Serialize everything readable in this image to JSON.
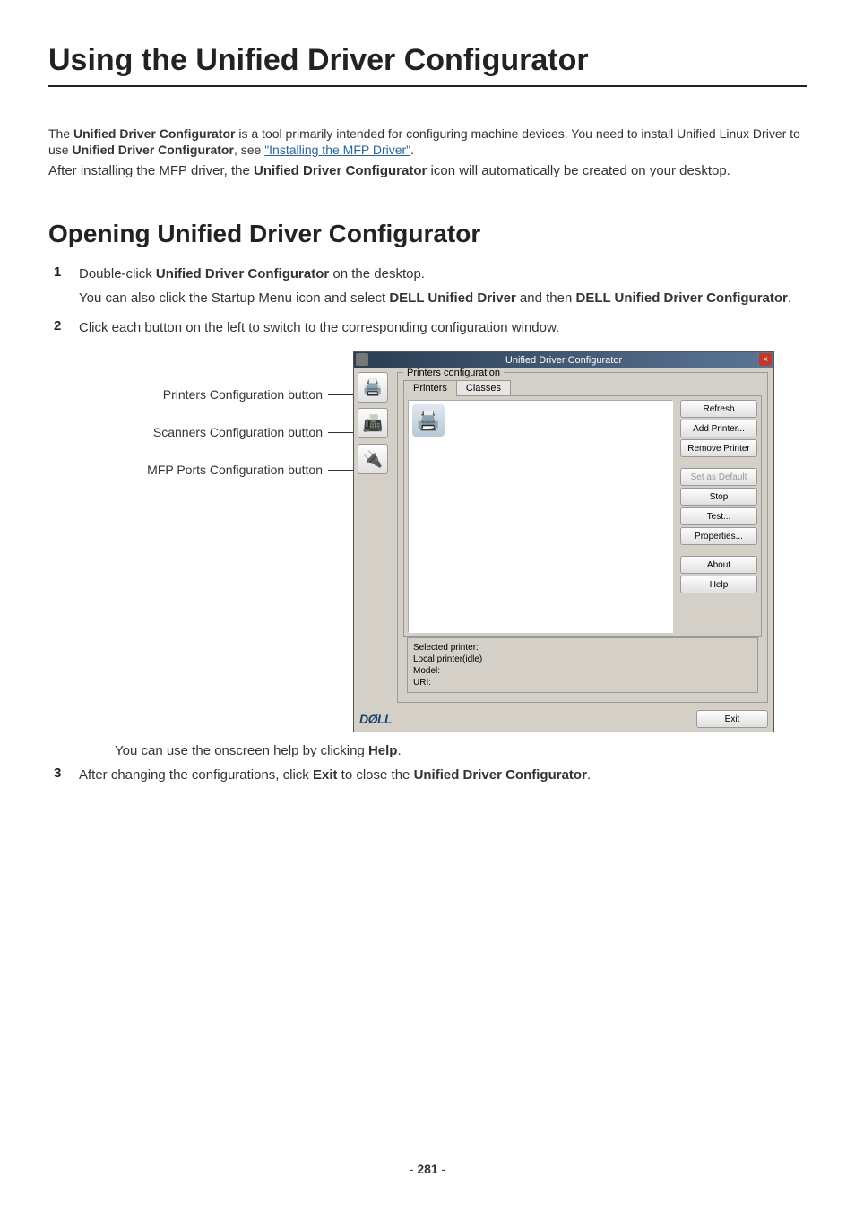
{
  "title": "Using the Unified Driver Configurator",
  "intro": {
    "line1_a": "The ",
    "line1_b": "Unified Driver Configurator",
    "line1_c": " is a tool primarily intended for configuring machine devices. You need to install Unified Linux Driver to use ",
    "line1_d": "Unified Driver Configurator",
    "line1_e": ", see ",
    "link": "\"Installing the MFP Driver\"",
    "line1_f": ".",
    "line2_a": "After installing the MFP driver, the ",
    "line2_b": "Unified Driver Configurator",
    "line2_c": " icon will automatically be created on your desktop."
  },
  "section_title": "Opening Unified Driver Configurator",
  "steps": {
    "s1": {
      "num": "1",
      "p1_a": "Double-click ",
      "p1_b": "Unified Driver Configurator",
      "p1_c": " on the desktop.",
      "p2_a": "You can also click the Startup Menu icon and select ",
      "p2_b": "DELL Unified Driver",
      "p2_c": " and then ",
      "p2_d": "DELL Unified Driver Configurator",
      "p2_e": "."
    },
    "s2": {
      "num": "2",
      "p1": "Click each button on the left to switch to the corresponding configuration window.",
      "p2_a": "You can use the onscreen help by clicking ",
      "p2_b": "Help",
      "p2_c": "."
    },
    "s3": {
      "num": "3",
      "p1_a": "After changing the configurations, click ",
      "p1_b": "Exit",
      "p1_c": " to close the ",
      "p1_d": "Unified Driver Configurator",
      "p1_e": "."
    }
  },
  "labels": {
    "printers": "Printers Configuration button",
    "scanners": "Scanners Configuration button",
    "ports": "MFP Ports Configuration button"
  },
  "dialog": {
    "title": "Unified Driver Configurator",
    "close": "×",
    "fieldset_title": "Printers configuration",
    "tabs": {
      "printers": "Printers",
      "classes": "Classes"
    },
    "buttons": {
      "refresh": "Refresh",
      "add": "Add Printer...",
      "remove": "Remove Printer",
      "setdefault": "Set as Default",
      "stop": "Stop",
      "test": "Test...",
      "properties": "Properties...",
      "about": "About",
      "help": "Help",
      "exit": "Exit"
    },
    "selected": {
      "l1": "Selected printer:",
      "l2": "Local printer(idle)",
      "l3": "Model:",
      "l4": "URI:"
    },
    "logo": "DØLL"
  },
  "page": {
    "pre": "- ",
    "num": "281",
    "post": " -"
  }
}
